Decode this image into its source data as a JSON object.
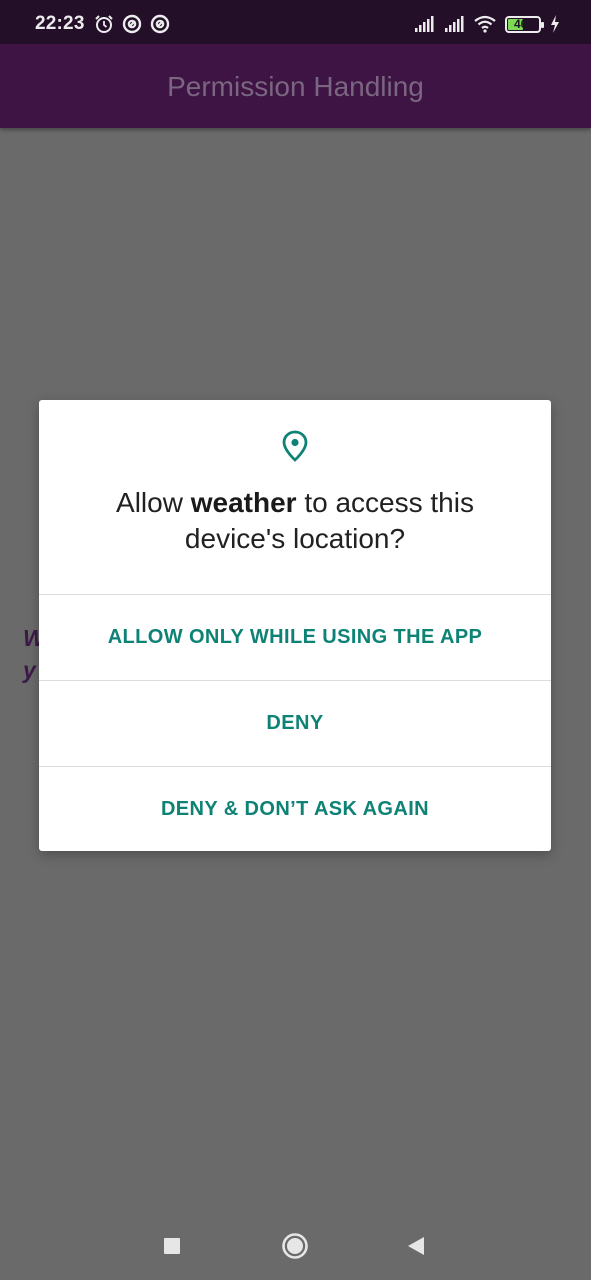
{
  "status_bar": {
    "time": "22:23",
    "battery_level": "46",
    "left_icons": [
      "alarm-icon",
      "at-sign-icon",
      "at-sign-icon"
    ],
    "right_icons": [
      "signal-icon",
      "signal-icon",
      "wifi-icon",
      "battery-icon",
      "charging-icon"
    ]
  },
  "app_bar": {
    "title": "Permission Handling"
  },
  "background": {
    "line1": "W",
    "line2": "y"
  },
  "dialog": {
    "icon": "location-pin-icon",
    "title_prefix": "Allow ",
    "title_app": "weather",
    "title_suffix_line1": " to access this",
    "title_line2": "device's location?",
    "buttons": {
      "allow": "ALLOW ONLY WHILE USING THE APP",
      "deny": "DENY",
      "deny_dont_ask": "DENY & DON’T ASK AGAIN"
    }
  },
  "nav_bar": {
    "icons": [
      "recents-square-icon",
      "home-circle-icon",
      "back-triangle-icon"
    ]
  },
  "colors": {
    "accent": "#0e8275",
    "app_bar": "#3e1444",
    "status_bar": "#240f29",
    "scrim": "#6a6a6a"
  }
}
